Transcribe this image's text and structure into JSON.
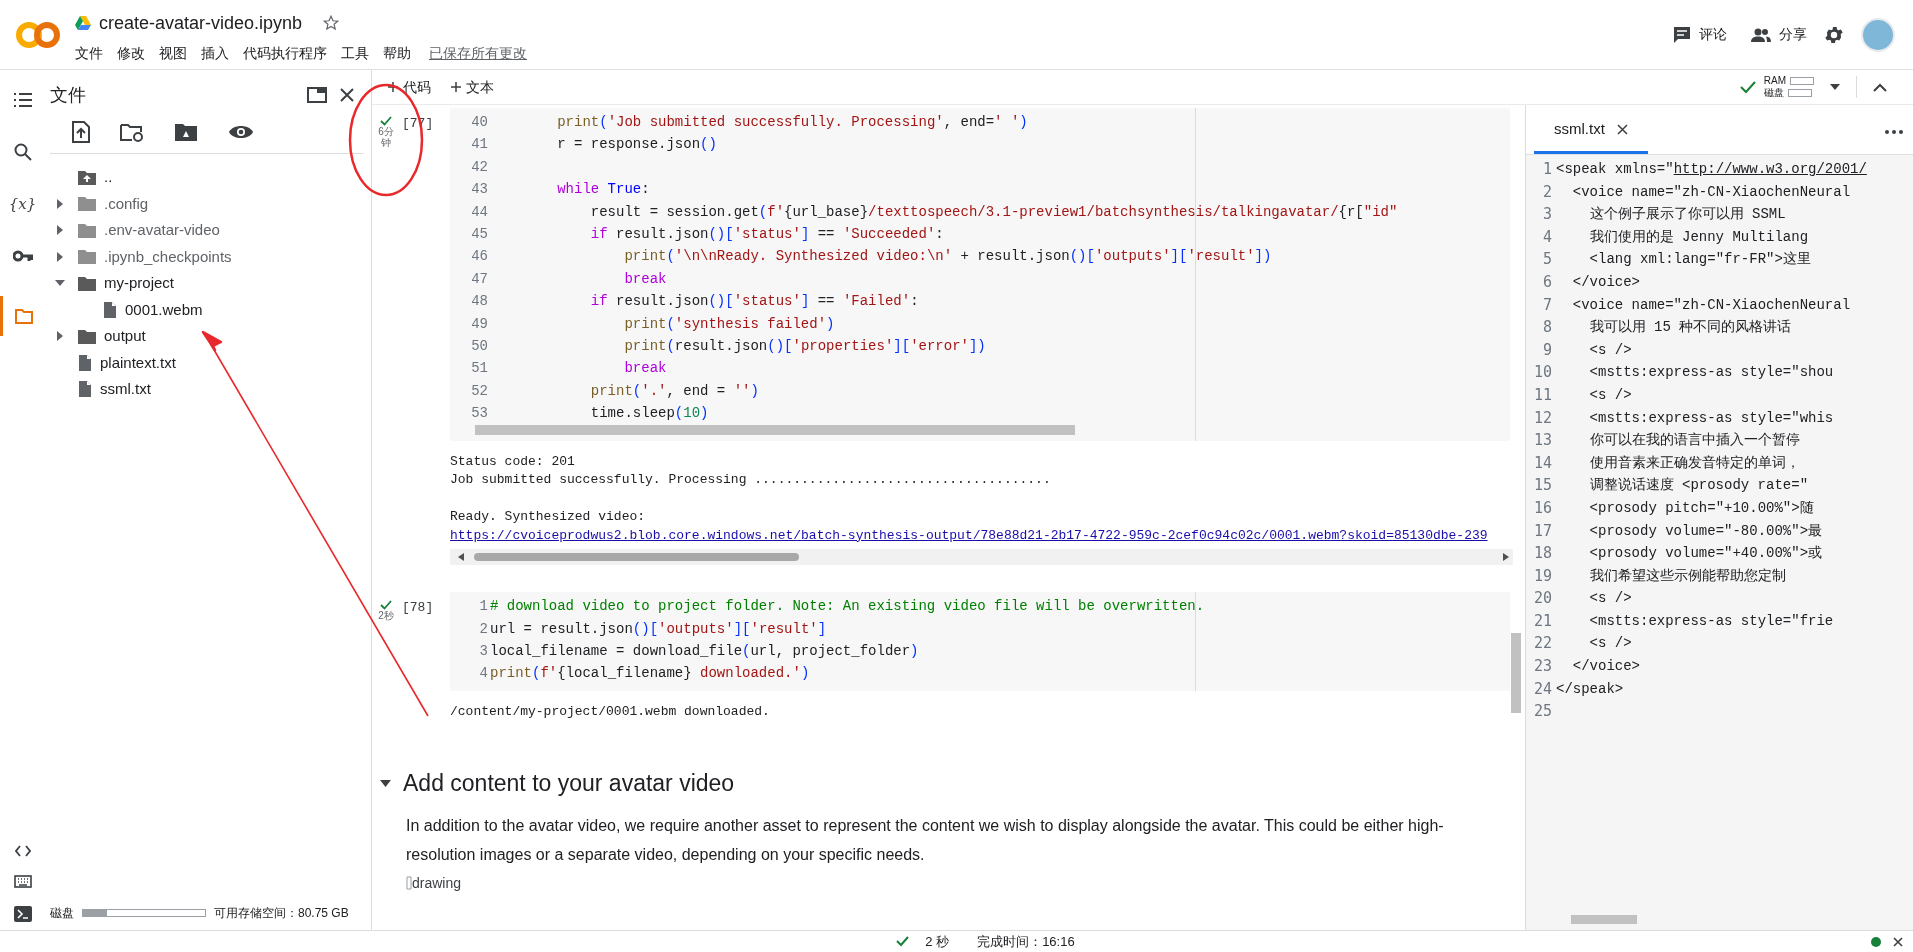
{
  "header": {
    "title": "create-avatar-video.ipynb",
    "menu": [
      "文件",
      "修改",
      "视图",
      "插入",
      "代码执行程序",
      "工具",
      "帮助"
    ],
    "save_status": "已保存所有更改",
    "actions": [
      {
        "kind": "comment",
        "label": "评论"
      },
      {
        "kind": "share",
        "label": "分享"
      }
    ]
  },
  "side_rail": [
    {
      "kind": "toc",
      "selected": false
    },
    {
      "kind": "search",
      "selected": false
    },
    {
      "kind": "variables",
      "glyph": "{x}",
      "selected": false
    },
    {
      "kind": "secrets",
      "selected": false
    },
    {
      "kind": "files",
      "selected": true
    }
  ],
  "files_panel": {
    "title": "文件",
    "tree": [
      {
        "kind": "parent",
        "label": ".."
      },
      {
        "kind": "folder",
        "label": ".config",
        "expanded": false,
        "dimmed": true
      },
      {
        "kind": "folder",
        "label": ".env-avatar-video",
        "expanded": false,
        "dimmed": true
      },
      {
        "kind": "folder",
        "label": ".ipynb_checkpoints",
        "expanded": false,
        "dimmed": true
      },
      {
        "kind": "folder",
        "label": "my-project",
        "expanded": true,
        "dimmed": false,
        "children": [
          {
            "kind": "file",
            "label": "0001.webm"
          }
        ]
      },
      {
        "kind": "folder",
        "label": "output",
        "expanded": false,
        "dimmed": false
      },
      {
        "kind": "file",
        "label": "plaintext.txt"
      },
      {
        "kind": "file",
        "label": "ssml.txt"
      }
    ],
    "disk": {
      "label": "磁盘",
      "level": 0.2,
      "free": "可用存储空间：80.75 GB"
    }
  },
  "toolbar": {
    "buttons": [
      "代码",
      "文本"
    ],
    "ram_label": "RAM",
    "disk_label": "磁盘"
  },
  "cells": [
    {
      "exec_count": "[77]",
      "run_time": "6分钟",
      "lines": [
        {
          "n": "40",
          "segs": [
            {
              "t": "        print",
              "kind": "function"
            },
            {
              "t": "(",
              "kind": "bracket"
            },
            {
              "t": "'Job submitted successfully. Processing'",
              "kind": "string"
            },
            {
              "t": ", end=",
              "kind": "plain"
            },
            {
              "t": "' '",
              "kind": "string"
            },
            {
              "t": ")",
              "kind": "bracket"
            }
          ]
        },
        {
          "n": "41",
          "segs": [
            {
              "t": "        r = response.json",
              "kind": "plain"
            },
            {
              "t": "()",
              "kind": "bracket"
            }
          ]
        },
        {
          "n": "42"
        },
        {
          "n": "43",
          "segs": [
            {
              "t": "        while",
              "kind": "keyword"
            },
            {
              "t": " True",
              "kind": "constant"
            },
            {
              "t": ":",
              "kind": "plain"
            }
          ]
        },
        {
          "n": "44",
          "segs": [
            {
              "t": "            result = session.get",
              "kind": "plain"
            },
            {
              "t": "(",
              "kind": "bracket"
            },
            {
              "t": "f'",
              "kind": "string"
            },
            {
              "t": "{url_base}",
              "kind": "plain"
            },
            {
              "t": "/texttospeech/3.1-preview1/batchsynthesis/talkingavatar/",
              "kind": "string"
            },
            {
              "t": "{r[",
              "kind": "plain"
            },
            {
              "t": "\"id\"",
              "kind": "string"
            }
          ]
        },
        {
          "n": "45",
          "segs": [
            {
              "t": "            if",
              "kind": "keyword"
            },
            {
              "t": " result.json",
              "kind": "plain"
            },
            {
              "t": "()[",
              "kind": "bracket"
            },
            {
              "t": "'status'",
              "kind": "string"
            },
            {
              "t": "]",
              "kind": "bracket"
            },
            {
              "t": " == ",
              "kind": "plain"
            },
            {
              "t": "'Succeeded'",
              "kind": "string"
            },
            {
              "t": ":",
              "kind": "plain"
            }
          ]
        },
        {
          "n": "46",
          "segs": [
            {
              "t": "                print",
              "kind": "function"
            },
            {
              "t": "(",
              "kind": "bracket"
            },
            {
              "t": "'\\n\\nReady. Synthesized video:\\n'",
              "kind": "string"
            },
            {
              "t": " + result.json",
              "kind": "plain"
            },
            {
              "t": "()[",
              "kind": "bracket"
            },
            {
              "t": "'outputs'",
              "kind": "string"
            },
            {
              "t": "][",
              "kind": "bracket"
            },
            {
              "t": "'result'",
              "kind": "string"
            },
            {
              "t": "])",
              "kind": "bracket"
            }
          ]
        },
        {
          "n": "47",
          "segs": [
            {
              "t": "                break",
              "kind": "keyword"
            }
          ]
        },
        {
          "n": "48",
          "segs": [
            {
              "t": "            if",
              "kind": "keyword"
            },
            {
              "t": " result.json",
              "kind": "plain"
            },
            {
              "t": "()[",
              "kind": "bracket"
            },
            {
              "t": "'status'",
              "kind": "string"
            },
            {
              "t": "]",
              "kind": "bracket"
            },
            {
              "t": " == ",
              "kind": "plain"
            },
            {
              "t": "'Failed'",
              "kind": "string"
            },
            {
              "t": ":",
              "kind": "plain"
            }
          ]
        },
        {
          "n": "49",
          "segs": [
            {
              "t": "                print",
              "kind": "function"
            },
            {
              "t": "(",
              "kind": "bracket"
            },
            {
              "t": "'synthesis failed'",
              "kind": "string"
            },
            {
              "t": ")",
              "kind": "bracket"
            }
          ]
        },
        {
          "n": "50",
          "segs": [
            {
              "t": "                print",
              "kind": "function"
            },
            {
              "t": "(",
              "kind": "bracket"
            },
            {
              "t": "result.json",
              "kind": "plain"
            },
            {
              "t": "()[",
              "kind": "bracket"
            },
            {
              "t": "'properties'",
              "kind": "string"
            },
            {
              "t": "][",
              "kind": "bracket"
            },
            {
              "t": "'error'",
              "kind": "string"
            },
            {
              "t": "])",
              "kind": "bracket"
            }
          ]
        },
        {
          "n": "51",
          "segs": [
            {
              "t": "                break",
              "kind": "keyword"
            }
          ]
        },
        {
          "n": "52",
          "segs": [
            {
              "t": "            print",
              "kind": "function"
            },
            {
              "t": "(",
              "kind": "bracket"
            },
            {
              "t": "'.'",
              "kind": "string"
            },
            {
              "t": ", end = ",
              "kind": "plain"
            },
            {
              "t": "''",
              "kind": "string"
            },
            {
              "t": ")",
              "kind": "bracket"
            }
          ]
        },
        {
          "n": "53",
          "segs": [
            {
              "t": "            time.sleep",
              "kind": "plain"
            },
            {
              "t": "(",
              "kind": "bracket"
            },
            {
              "t": "10",
              "kind": "number"
            },
            {
              "t": ")",
              "kind": "bracket"
            }
          ]
        }
      ],
      "output": [
        {
          "kind": "text",
          "text": "Status code: 201"
        },
        {
          "kind": "text",
          "text": "Job submitted successfully. Processing ......................................"
        },
        {
          "kind": "blank"
        },
        {
          "kind": "text",
          "text": "Ready. Synthesized video:"
        },
        {
          "kind": "link",
          "text": "https://cvoiceprodwus2.blob.core.windows.net/batch-synthesis-output/78e88d21-2b17-4722-959c-2cef0c94c02c/0001.webm?skoid=85130dbe-239"
        }
      ],
      "output_scrollbar": true
    },
    {
      "exec_count": "[78]",
      "run_time": "2秒",
      "lines": [
        {
          "n": "1",
          "segs": [
            {
              "t": "# download video to project folder. Note: An existing video file will be overwritten.",
              "kind": "comment"
            }
          ]
        },
        {
          "n": "2",
          "segs": [
            {
              "t": "url = result.json",
              "kind": "plain"
            },
            {
              "t": "()[",
              "kind": "bracket"
            },
            {
              "t": "'outputs'",
              "kind": "string"
            },
            {
              "t": "][",
              "kind": "bracket"
            },
            {
              "t": "'result'",
              "kind": "string"
            },
            {
              "t": "]",
              "kind": "bracket"
            }
          ]
        },
        {
          "n": "3",
          "segs": [
            {
              "t": "local_filename = download_file",
              "kind": "plain"
            },
            {
              "t": "(",
              "kind": "bracket"
            },
            {
              "t": "url, project_folder",
              "kind": "plain"
            },
            {
              "t": ")",
              "kind": "bracket"
            }
          ]
        },
        {
          "n": "4",
          "segs": [
            {
              "t": "print",
              "kind": "function"
            },
            {
              "t": "(",
              "kind": "bracket"
            },
            {
              "t": "f'",
              "kind": "string"
            },
            {
              "t": "{local_filename}",
              "kind": "plain"
            },
            {
              "t": " downloaded.'",
              "kind": "string"
            },
            {
              "t": ")",
              "kind": "bracket"
            }
          ]
        }
      ],
      "output": [
        {
          "kind": "text",
          "text": "/content/my-project/0001.webm downloaded."
        }
      ],
      "output_scrollbar": false
    }
  ],
  "markdown": {
    "heading": "Add content to your avatar video",
    "expanded": true,
    "paragraph": "In addition to the avatar video, we require another asset to represent the content we wish to display alongside the avatar. This could be either high-resolution images or a separate video, depending on your specific needs.",
    "image_alt": "drawing"
  },
  "editor": {
    "tab": "ssml.txt",
    "lines": [
      {
        "n": "1",
        "segs": [
          {
            "t": "<speak xmlns=\"",
            "kind": "plain"
          },
          {
            "t": "http://www.w3.org/2001/",
            "kind": "link"
          }
        ]
      },
      {
        "n": "2",
        "segs": [
          {
            "t": "  <voice name=\"zh-CN-XiaochenNeural",
            "kind": "plain"
          }
        ]
      },
      {
        "n": "3",
        "segs": [
          {
            "t": "    这个例子展示了你可以用 SSML",
            "kind": "plain"
          }
        ]
      },
      {
        "n": "4",
        "segs": [
          {
            "t": "    我们使用的是 Jenny Multilang",
            "kind": "plain"
          }
        ]
      },
      {
        "n": "5",
        "segs": [
          {
            "t": "    <lang xml:lang=\"fr-FR\">这里",
            "kind": "plain"
          }
        ]
      },
      {
        "n": "6",
        "segs": [
          {
            "t": "  </voice>",
            "kind": "plain"
          }
        ]
      },
      {
        "n": "7",
        "segs": [
          {
            "t": "  <voice name=\"zh-CN-XiaochenNeural",
            "kind": "plain"
          }
        ]
      },
      {
        "n": "8",
        "segs": [
          {
            "t": "    我可以用 15 种不同的风格讲话",
            "kind": "plain"
          }
        ]
      },
      {
        "n": "9",
        "segs": [
          {
            "t": "    <s />",
            "kind": "plain"
          }
        ]
      },
      {
        "n": "10",
        "segs": [
          {
            "t": "    <mstts:express-as style=\"shou",
            "kind": "plain"
          }
        ]
      },
      {
        "n": "11",
        "segs": [
          {
            "t": "    <s />",
            "kind": "plain"
          }
        ]
      },
      {
        "n": "12",
        "segs": [
          {
            "t": "    <mstts:express-as style=\"whis",
            "kind": "plain"
          }
        ]
      },
      {
        "n": "13",
        "segs": [
          {
            "t": "    你可以在我的语言中插入一个暂停",
            "kind": "plain"
          }
        ]
      },
      {
        "n": "14",
        "segs": [
          {
            "t": "    使用音素来正确发音特定的单词，",
            "kind": "plain"
          }
        ]
      },
      {
        "n": "15",
        "segs": [
          {
            "t": "    调整说话速度 <prosody rate=\"",
            "kind": "plain"
          }
        ]
      },
      {
        "n": "16",
        "segs": [
          {
            "t": "    <prosody pitch=\"+10.00%\">随",
            "kind": "plain"
          }
        ]
      },
      {
        "n": "17",
        "segs": [
          {
            "t": "    <prosody volume=\"-80.00%\">最",
            "kind": "plain"
          }
        ]
      },
      {
        "n": "18",
        "segs": [
          {
            "t": "    <prosody volume=\"+40.00%\">或",
            "kind": "plain"
          }
        ]
      },
      {
        "n": "19",
        "segs": [
          {
            "t": "    我们希望这些示例能帮助您定制",
            "kind": "plain"
          }
        ]
      },
      {
        "n": "20",
        "segs": [
          {
            "t": "    <s />",
            "kind": "plain"
          }
        ]
      },
      {
        "n": "21",
        "segs": [
          {
            "t": "    <mstts:express-as style=\"frie",
            "kind": "plain"
          }
        ]
      },
      {
        "n": "22",
        "segs": [
          {
            "t": "    <s />",
            "kind": "plain"
          }
        ]
      },
      {
        "n": "23",
        "segs": [
          {
            "t": "  </voice>",
            "kind": "plain"
          }
        ]
      },
      {
        "n": "24",
        "segs": [
          {
            "t": "</speak>",
            "kind": "plain"
          }
        ]
      },
      {
        "n": "25"
      }
    ]
  },
  "status_bar": {
    "duration": "2 秒",
    "finished": "完成时间：16:16"
  }
}
